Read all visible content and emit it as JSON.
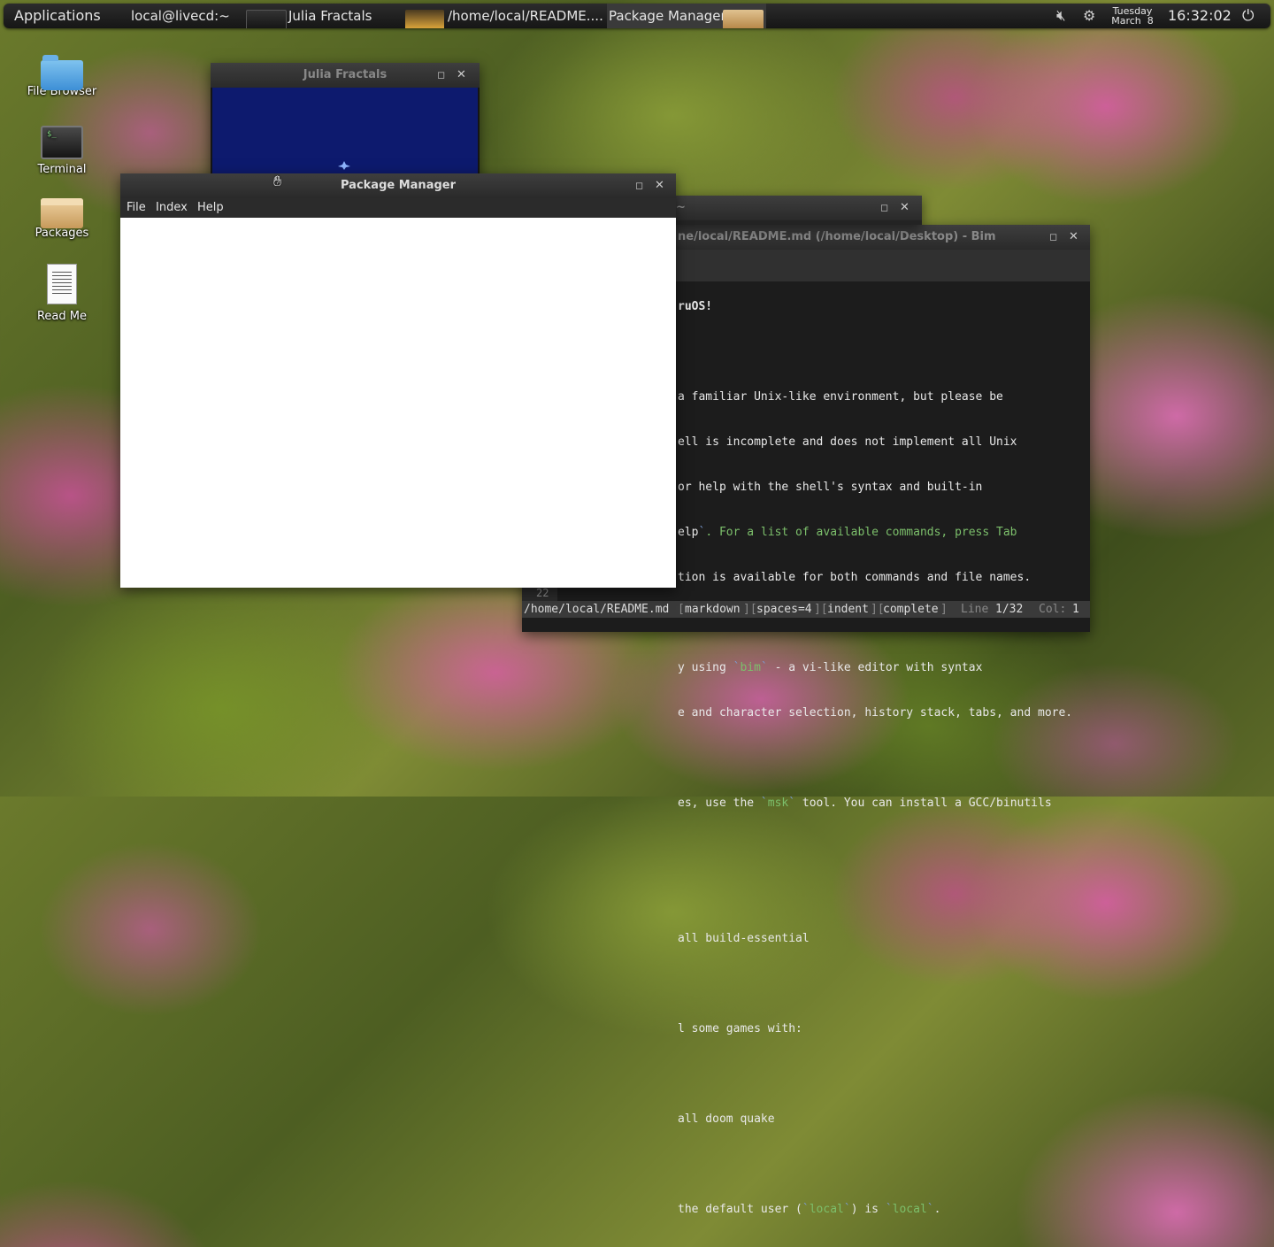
{
  "panel": {
    "applications": "Applications",
    "user_label": "local@livecd:~",
    "tasks": [
      {
        "label": "Julia Fractals"
      },
      {
        "label": "/home/local/README...."
      },
      {
        "label": "Package Manager"
      }
    ],
    "clock": {
      "day": "Tuesday",
      "date": "March  8",
      "time": "16:32:02"
    },
    "icons": {
      "volume": "volume-muted-icon",
      "network": "network-icon",
      "power": "power-icon"
    }
  },
  "desktop_icons": [
    {
      "label": "File Browser",
      "icon": "folder-icon"
    },
    {
      "label": "Terminal",
      "icon": "terminal-icon"
    },
    {
      "label": "Packages",
      "icon": "package-icon"
    },
    {
      "label": "Read Me",
      "icon": "document-icon"
    }
  ],
  "julia_window": {
    "title": "Julia Fractals"
  },
  "package_manager": {
    "title": "Package Manager",
    "menu": [
      "File",
      "Index",
      "Help"
    ]
  },
  "middle_window": {
    "title": "~"
  },
  "readme_window": {
    "title": "ne/local/README.md (/home/local/Desktop) - Bim",
    "lines": [
      "ruOS!",
      "",
      "a familiar Unix-like environment, but please be",
      "ell is incomplete and does not implement all Unix",
      "or help with the shell's syntax and built-in",
      "elp`. For a list of available commands, press Tab",
      "tion is available for both commands and file names.",
      "",
      "y using `bim` - a vi-like editor with syntax",
      "e and character selection, history stack, tabs, and more.",
      "",
      "es, use the `msk` tool. You can install a GCC/binutils",
      "",
      "",
      "all build-essential",
      "",
      "l some games with:",
      "",
      "all doom quake",
      "",
      "the default user (`local`) is `local`."
    ],
    "line_number": "22",
    "status": {
      "file": "/home/local/README.md",
      "tags": [
        "markdown",
        "spaces=4",
        "indent",
        "complete"
      ],
      "line_label": "Line",
      "line_value": "1/32",
      "col_label": "Col:",
      "col_value": "1"
    }
  },
  "colors": {
    "panel_bg": "#1e1e1e",
    "julia_canvas": "#0d1a6e",
    "code_green": "#7cbf6b",
    "code_tick": "#7c9cd6"
  }
}
